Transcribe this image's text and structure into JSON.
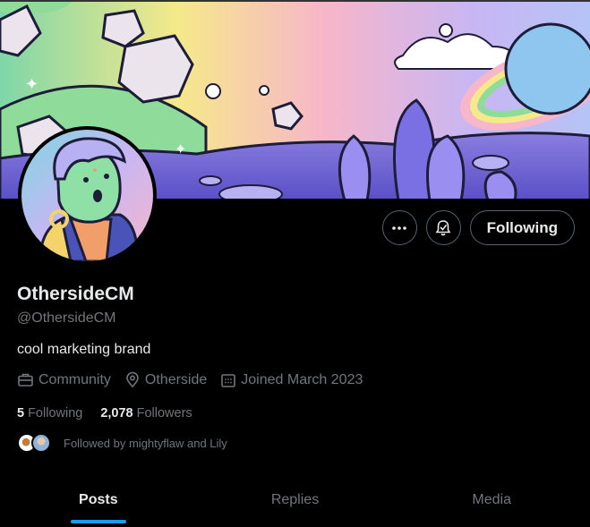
{
  "profile": {
    "name": "OthersideCM",
    "handle": "@OthersideCM",
    "bio": "cool marketing brand",
    "category": "Community",
    "location": "Otherside",
    "joined": "Joined March 2023"
  },
  "counts": {
    "following_value": "5",
    "following_label": "Following",
    "followers_value": "2,078",
    "followers_label": "Followers"
  },
  "followed_by": "Followed by mightyflaw and Lily",
  "actions": {
    "follow_label": "Following",
    "more_icon": "more-icon",
    "notify_icon": "bell-icon"
  },
  "tabs": [
    "Posts",
    "Replies",
    "Media"
  ],
  "colors": {
    "accent": "#1d9bf0",
    "muted": "#71767b",
    "text": "#e7e9ea"
  }
}
